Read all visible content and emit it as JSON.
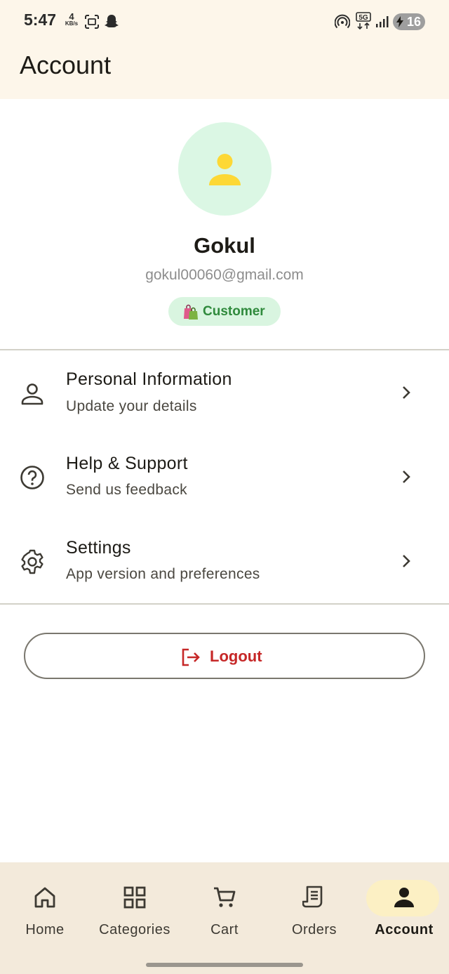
{
  "status_bar": {
    "time": "5:47",
    "net_speed_value": "4",
    "net_speed_unit": "KB/s",
    "network_type": "5G",
    "battery_level": "16",
    "icons": [
      "screenshot-icon",
      "snapchat-icon",
      "hotspot-icon",
      "5g-icon",
      "signal-icon",
      "battery-charging-icon"
    ]
  },
  "app_bar": {
    "title": "Account"
  },
  "profile": {
    "name": "Gokul",
    "email": "gokul00060@gmail.com",
    "role_label": "Customer",
    "role_icon": "shopping-bags-icon",
    "avatar_icon": "person-icon",
    "avatar_bg": "#dbf7e4",
    "avatar_icon_color": "#fdd835"
  },
  "menu": [
    {
      "title": "Personal Information",
      "subtitle": "Update your details",
      "icon": "person-outline-icon"
    },
    {
      "title": "Help & Support",
      "subtitle": "Send us feedback",
      "icon": "help-circle-icon"
    },
    {
      "title": "Settings",
      "subtitle": "App version and preferences",
      "icon": "gear-icon"
    }
  ],
  "logout": {
    "label": "Logout",
    "icon": "logout-icon",
    "color": "#c62828"
  },
  "bottom_nav": {
    "items": [
      {
        "label": "Home",
        "icon": "home-icon"
      },
      {
        "label": "Categories",
        "icon": "grid-icon"
      },
      {
        "label": "Cart",
        "icon": "cart-icon"
      },
      {
        "label": "Orders",
        "icon": "receipt-icon"
      },
      {
        "label": "Account",
        "icon": "person-icon"
      }
    ],
    "active": "Account",
    "active_pill_color": "#fcf0c4"
  },
  "colors": {
    "header_bg": "#fdf6ea",
    "nav_bg": "#f3eadb",
    "chip_bg": "#d9f5e0",
    "chip_text": "#2f8a3c"
  }
}
